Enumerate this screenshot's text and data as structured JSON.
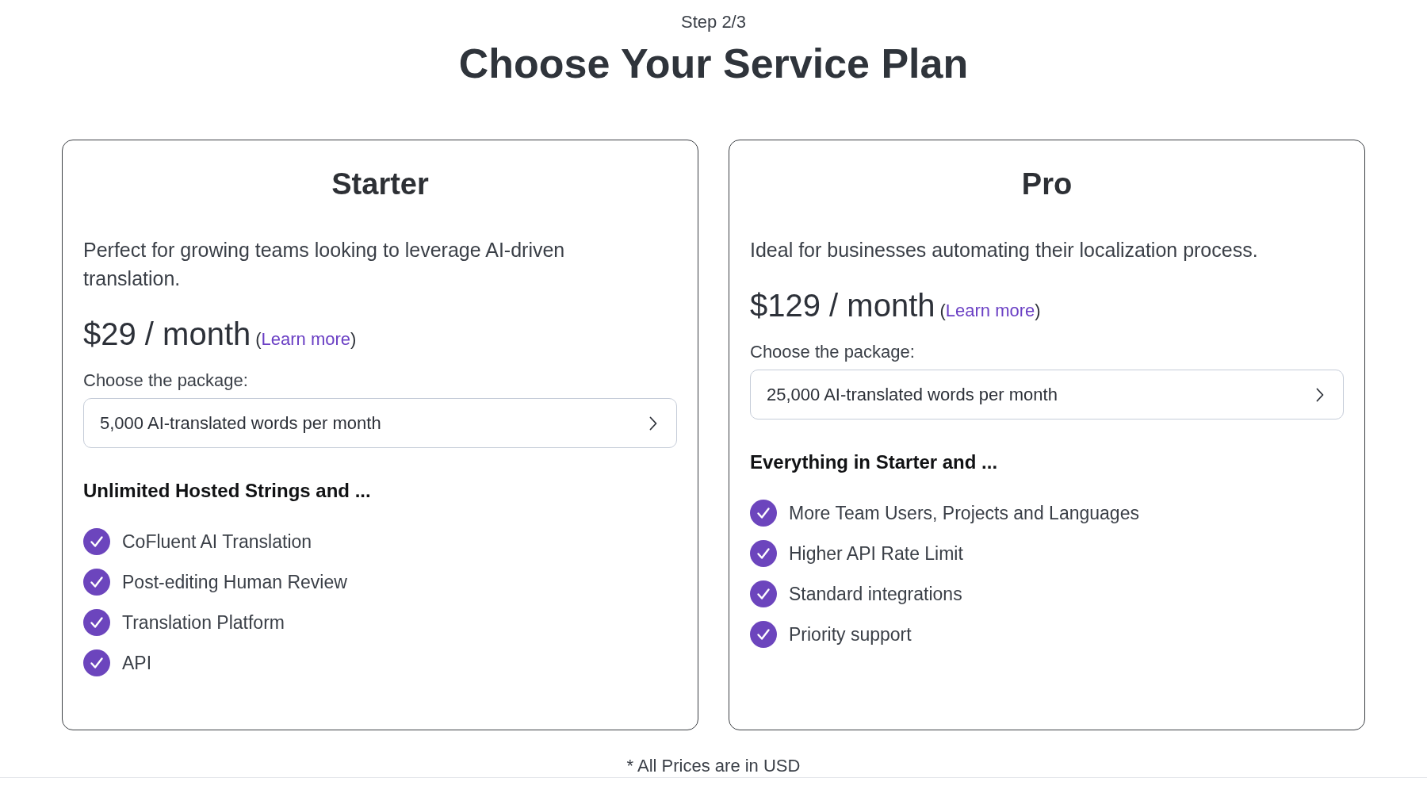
{
  "header": {
    "step": "Step 2/3",
    "title": "Choose Your Service Plan"
  },
  "plans": [
    {
      "name": "Starter",
      "description": "Perfect for growing teams looking to leverage AI-driven translation.",
      "price": "$29 / month",
      "learn_more": {
        "open": "(",
        "label": "Learn more",
        "close": ")"
      },
      "package_label": "Choose the package:",
      "package": "5,000 AI-translated words per month",
      "features_heading": "Unlimited Hosted Strings and ...",
      "features": [
        "CoFluent AI Translation",
        "Post-editing Human Review",
        "Translation Platform",
        "API"
      ]
    },
    {
      "name": "Pro",
      "description": "Ideal for businesses automating their localization process.",
      "price": "$129 / month",
      "learn_more": {
        "open": "(",
        "label": "Learn more",
        "close": ")"
      },
      "package_label": "Choose the package:",
      "package": "25,000 AI-translated words per month",
      "features_heading": "Everything in Starter and ...",
      "features": [
        "More Team Users, Projects and Languages",
        "Higher API Rate Limit",
        "Standard integrations",
        "Priority support"
      ]
    }
  ],
  "footer": {
    "note": "* All Prices are in USD"
  }
}
